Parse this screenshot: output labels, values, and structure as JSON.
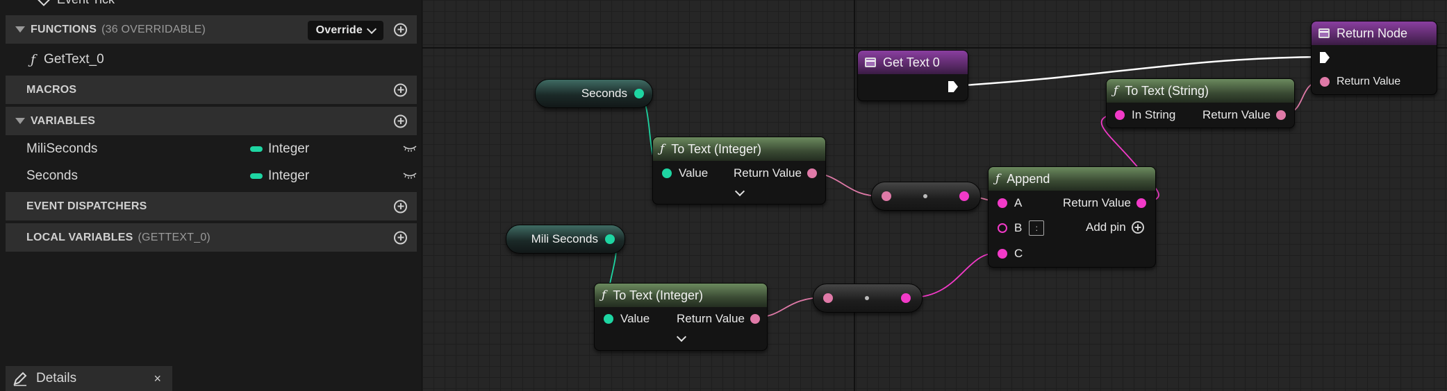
{
  "sidebar": {
    "top_item": "Event Tick",
    "functions": {
      "title": "FUNCTIONS",
      "subtitle": "(36 OVERRIDABLE)",
      "override_label": "Override",
      "items": [
        "GetText_0"
      ]
    },
    "macros": {
      "title": "MACROS"
    },
    "variables": {
      "title": "VARIABLES",
      "items": [
        {
          "name": "MiliSeconds",
          "type": "Integer",
          "type_color": "#1ed5a2"
        },
        {
          "name": "Seconds",
          "type": "Integer",
          "type_color": "#1ed5a2"
        }
      ]
    },
    "event_dispatchers": {
      "title": "EVENT DISPATCHERS"
    },
    "local_variables": {
      "title": "LOCAL VARIABLES",
      "subtitle": "(GETTEXT_0)"
    }
  },
  "details_tab": {
    "label": "Details",
    "close": "×"
  },
  "graph": {
    "nodes": {
      "get_text": {
        "title": "Get Text 0"
      },
      "return_node": {
        "title": "Return Node",
        "pin": "Return Value"
      },
      "seconds_var": {
        "label": "Seconds"
      },
      "mili_seconds_var": {
        "label": "Mili Seconds"
      },
      "to_text_int_1": {
        "title": "To Text (Integer)",
        "in": "Value",
        "out": "Return Value"
      },
      "to_text_int_2": {
        "title": "To Text (Integer)",
        "in": "Value",
        "out": "Return Value"
      },
      "to_text_string": {
        "title": "To Text (String)",
        "in": "In String",
        "out": "Return Value"
      },
      "append": {
        "title": "Append",
        "a": "A",
        "b": "B",
        "b_value": ":",
        "c": "C",
        "out": "Return Value",
        "add_pin": "Add pin"
      }
    },
    "colors": {
      "integer_pin": "#1ed5a2",
      "string_pin": "#f23ac8",
      "text_pin": "#e07aa8",
      "function_header": "#6b8a5e",
      "pure_header": "#8a3fa0"
    }
  }
}
